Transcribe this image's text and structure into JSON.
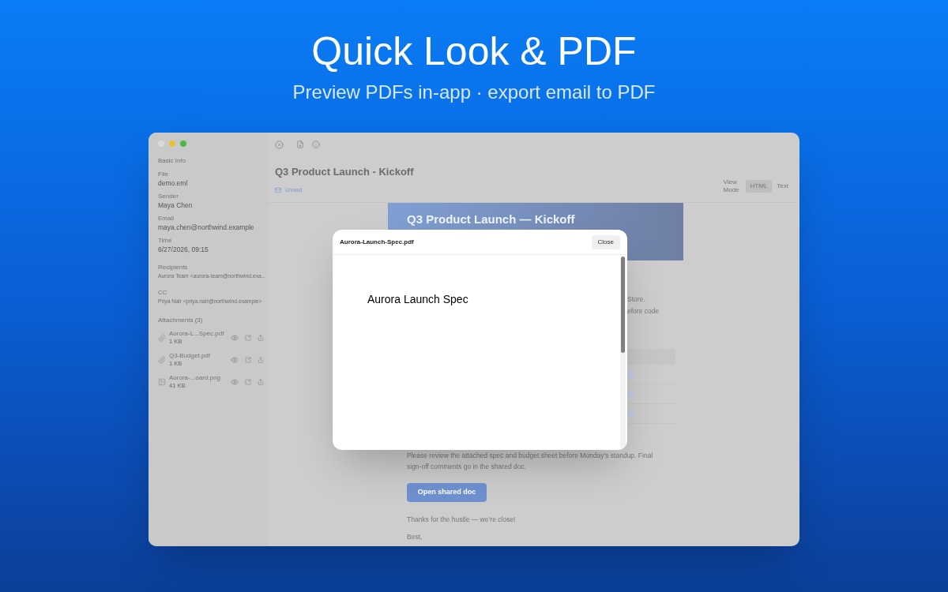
{
  "hero": {
    "title": "Quick Look & PDF",
    "subtitle": "Preview PDFs in-app · export email to PDF"
  },
  "sidebar": {
    "section_title": "Basic Info",
    "fields": [
      {
        "label": "File",
        "value": "demo.eml"
      },
      {
        "label": "Sender",
        "value": "Maya Chen"
      },
      {
        "label": "Email",
        "value": "maya.chen@northwind.example"
      },
      {
        "label": "Time",
        "value": "6/27/2026, 09:15"
      }
    ],
    "recipients": {
      "label": "Recipients",
      "value": "Aurora Team <aurora-team@northwind.exa..."
    },
    "cc": {
      "label": "CC",
      "value": "Priya Nair <priya.nair@northwind.example>"
    },
    "attachments": {
      "title": "Attachments (3)",
      "items": [
        {
          "kind": "file",
          "name": "Aurora-L...Spec.pdf",
          "size": "1 KB"
        },
        {
          "kind": "file",
          "name": "Q3-Budget.pdf",
          "size": "1 KB"
        },
        {
          "kind": "image",
          "name": "Aurora-...oard.png",
          "size": "41 KB"
        }
      ]
    }
  },
  "message": {
    "title": "Q3 Product Launch - Kickoff",
    "status": "Unread",
    "view_mode": {
      "label": "View Mode",
      "options": [
        {
          "label": "HTML",
          "selected": true
        },
        {
          "label": "Text",
          "selected": false
        }
      ]
    },
    "body": {
      "banner_title": "Q3 Product Launch — Kickoff",
      "fragments": [
        "Store.",
        "efore code"
      ],
      "paragraph": "Please review the attached spec and budget sheet before Monday’s standup. Final sign-off comments go in the shared doc.",
      "button": "Open shared doc",
      "closing": "Thanks for the hustle — we’re close!",
      "signoff": "Best,"
    }
  },
  "modal": {
    "title": "Aurora-Launch-Spec.pdf",
    "close": "Close",
    "page_title": "Aurora Launch Spec"
  }
}
